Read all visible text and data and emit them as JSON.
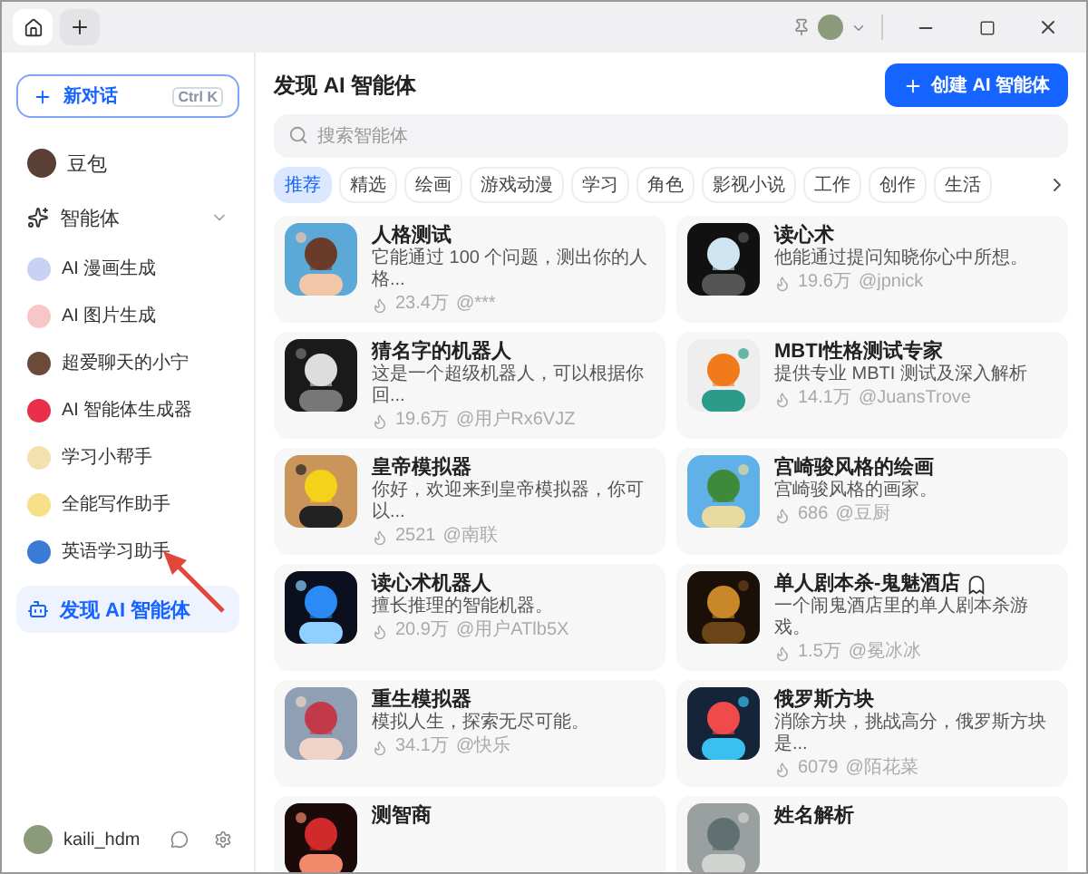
{
  "sidebar": {
    "new_chat": {
      "label": "新对话",
      "shortcut": "Ctrl K"
    },
    "items": [
      {
        "label": "豆包",
        "selected": false
      }
    ],
    "section": {
      "label": "智能体",
      "expanded": true,
      "children": [
        {
          "label": "AI 漫画生成",
          "selected": false
        },
        {
          "label": "AI 图片生成",
          "selected": false
        },
        {
          "label": "超爱聊天的小宁",
          "selected": false
        },
        {
          "label": "AI 智能体生成器",
          "selected": false
        },
        {
          "label": "学习小帮手",
          "selected": false
        },
        {
          "label": "全能写作助手",
          "selected": false
        },
        {
          "label": "英语学习助手",
          "selected": false
        }
      ]
    },
    "discover": {
      "label": "发现 AI 智能体",
      "selected": true
    },
    "user": {
      "name": "kaili_hdm"
    }
  },
  "main": {
    "title": "发现 AI 智能体",
    "create_button": "创建 AI 智能体",
    "search": {
      "placeholder": "搜索智能体"
    },
    "categories": [
      {
        "label": "推荐",
        "selected": true
      },
      {
        "label": "精选",
        "selected": false
      },
      {
        "label": "绘画",
        "selected": false
      },
      {
        "label": "游戏动漫",
        "selected": false
      },
      {
        "label": "学习",
        "selected": false
      },
      {
        "label": "角色",
        "selected": false
      },
      {
        "label": "影视小说",
        "selected": false
      },
      {
        "label": "工作",
        "selected": false
      },
      {
        "label": "创作",
        "selected": false
      },
      {
        "label": "生活",
        "selected": false
      }
    ],
    "cards": [
      {
        "title": "人格测试",
        "desc": "它能通过 100 个问题，测出你的人格...",
        "likes": "23.4万",
        "author": "@***"
      },
      {
        "title": "读心术",
        "desc": "他能通过提问知晓你心中所想。",
        "likes": "19.6万",
        "author": "@jpnick"
      },
      {
        "title": "猜名字的机器人",
        "desc": "这是一个超级机器人，可以根据你回...",
        "likes": "19.6万",
        "author": "@用户Rx6VJZ"
      },
      {
        "title": "MBTI性格测试专家",
        "desc": "提供专业 MBTI 测试及深入解析",
        "likes": "14.1万",
        "author": "@JuansTrove"
      },
      {
        "title": "皇帝模拟器",
        "desc": "你好，欢迎来到皇帝模拟器，你可以...",
        "likes": "2521",
        "author": "@南联"
      },
      {
        "title": "宫崎骏风格的绘画",
        "desc": "宫崎骏风格的画家。",
        "likes": "686",
        "author": "@豆厨"
      },
      {
        "title": "读心术机器人",
        "desc": "擅长推理的智能机器。",
        "likes": "20.9万",
        "author": "@用户ATlb5X"
      },
      {
        "title": "单人剧本杀-鬼魅酒店",
        "desc": "一个闹鬼酒店里的单人剧本杀游戏。",
        "likes": "1.5万",
        "author": "@冕冰冰",
        "badge": true
      },
      {
        "title": "重生模拟器",
        "desc": "模拟人生，探索无尽可能。",
        "likes": "34.1万",
        "author": "@快乐"
      },
      {
        "title": "俄罗斯方块",
        "desc": "消除方块，挑战高分，俄罗斯方块是...",
        "likes": "6079",
        "author": "@陌花菜"
      },
      {
        "title": "测智商"
      },
      {
        "title": "姓名解析"
      }
    ]
  }
}
